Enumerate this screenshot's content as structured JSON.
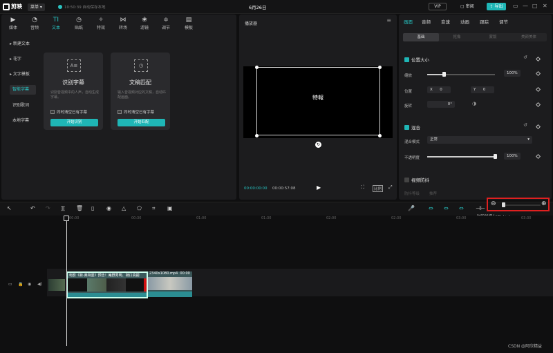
{
  "app": {
    "name": "剪映",
    "menu_label": "菜单",
    "autosave_text": "10:50:39 自动保存本地",
    "project_title": "6月26日",
    "vip_label": "VIP",
    "review_label": "审阅",
    "export_label": "导出",
    "window_controls": [
      "▭",
      "—",
      "□",
      "✕"
    ]
  },
  "toolbar": {
    "tabs": [
      {
        "label": "媒体",
        "icon": "▶"
      },
      {
        "label": "音频",
        "icon": "◔"
      },
      {
        "label": "文本",
        "icon": "TI"
      },
      {
        "label": "贴纸",
        "icon": "◷"
      },
      {
        "label": "特效",
        "icon": "✧"
      },
      {
        "label": "转场",
        "icon": "⋈"
      },
      {
        "label": "滤镜",
        "icon": "❀"
      },
      {
        "label": "调节",
        "icon": "≑"
      },
      {
        "label": "模板",
        "icon": "▤"
      }
    ]
  },
  "text_sidebar": {
    "items": [
      "新建文本",
      "花字",
      "文字模板",
      "智能字幕",
      "识别歌词",
      "本地字幕"
    ]
  },
  "cards": {
    "caption": {
      "icon": "A≡",
      "title": "识别字幕",
      "desc": "识别音视频中的人声，自动生成字幕。",
      "check": "同时清空已有字幕",
      "button": "开始识别"
    },
    "lyrics": {
      "icon": "◷",
      "title": "文稿匹配",
      "desc": "输入音视频对应的文稿，自动匹配画面。",
      "check": "同时清空已有字幕",
      "button": "开始匹配"
    }
  },
  "player": {
    "title": "播放器",
    "menu_icon": "≡",
    "canvas_text": "特報",
    "current_time": "00:00:00:00",
    "total_time": "00:00:57:08",
    "ratio_label": "比例"
  },
  "props": {
    "tabs": [
      "画面",
      "音频",
      "变速",
      "动画",
      "跟踪",
      "调节"
    ],
    "subtabs": [
      "基础",
      "抠像",
      "蒙版",
      "美颜美体"
    ],
    "position_size": {
      "header": "位置大小",
      "scale_label": "缩放",
      "scale_value": "100%",
      "scale_level": 0.25,
      "position_label": "位置",
      "x_label": "X",
      "x_value": "0",
      "y_label": "Y",
      "y_value": "0",
      "rotate_label": "旋转",
      "rotate_value": "0°"
    },
    "blend": {
      "header": "混合",
      "mode_label": "混合模式",
      "mode_value": "正常",
      "opacity_label": "不透明度",
      "opacity_value": "100%",
      "opacity_level": 1.0
    },
    "stabilize": {
      "header": "视频防抖",
      "level_label": "防抖等级",
      "level_value": "推荐"
    }
  },
  "timeline": {
    "tools": [
      "↖",
      "↶",
      "↷",
      "][",
      "🗑",
      "▯",
      "◉",
      "△",
      "⬠",
      "⌗",
      "▣"
    ],
    "right_tools": [
      "🎤",
      "⇔",
      "⇔",
      "⇔",
      "⊣⊢"
    ],
    "zoom_out_icon": "⊖",
    "zoom_in_icon": "⊕",
    "zoom_level": 0.05,
    "tooltip": "时间线缩小(Ctrl+-)",
    "ruler": [
      "00:00",
      "00:30",
      "01:00",
      "01:30",
      "02:00",
      "02:30",
      "03:00",
      "03:30"
    ],
    "clip1_name": "电影《新·奥特曼》预告！庵野秀明、樋口真嗣",
    "clip2_name": "2340x1080.mp4",
    "clip2_time": "00:00",
    "cover_label": "封面"
  },
  "watermark": "CSDN @阿欣精益"
}
